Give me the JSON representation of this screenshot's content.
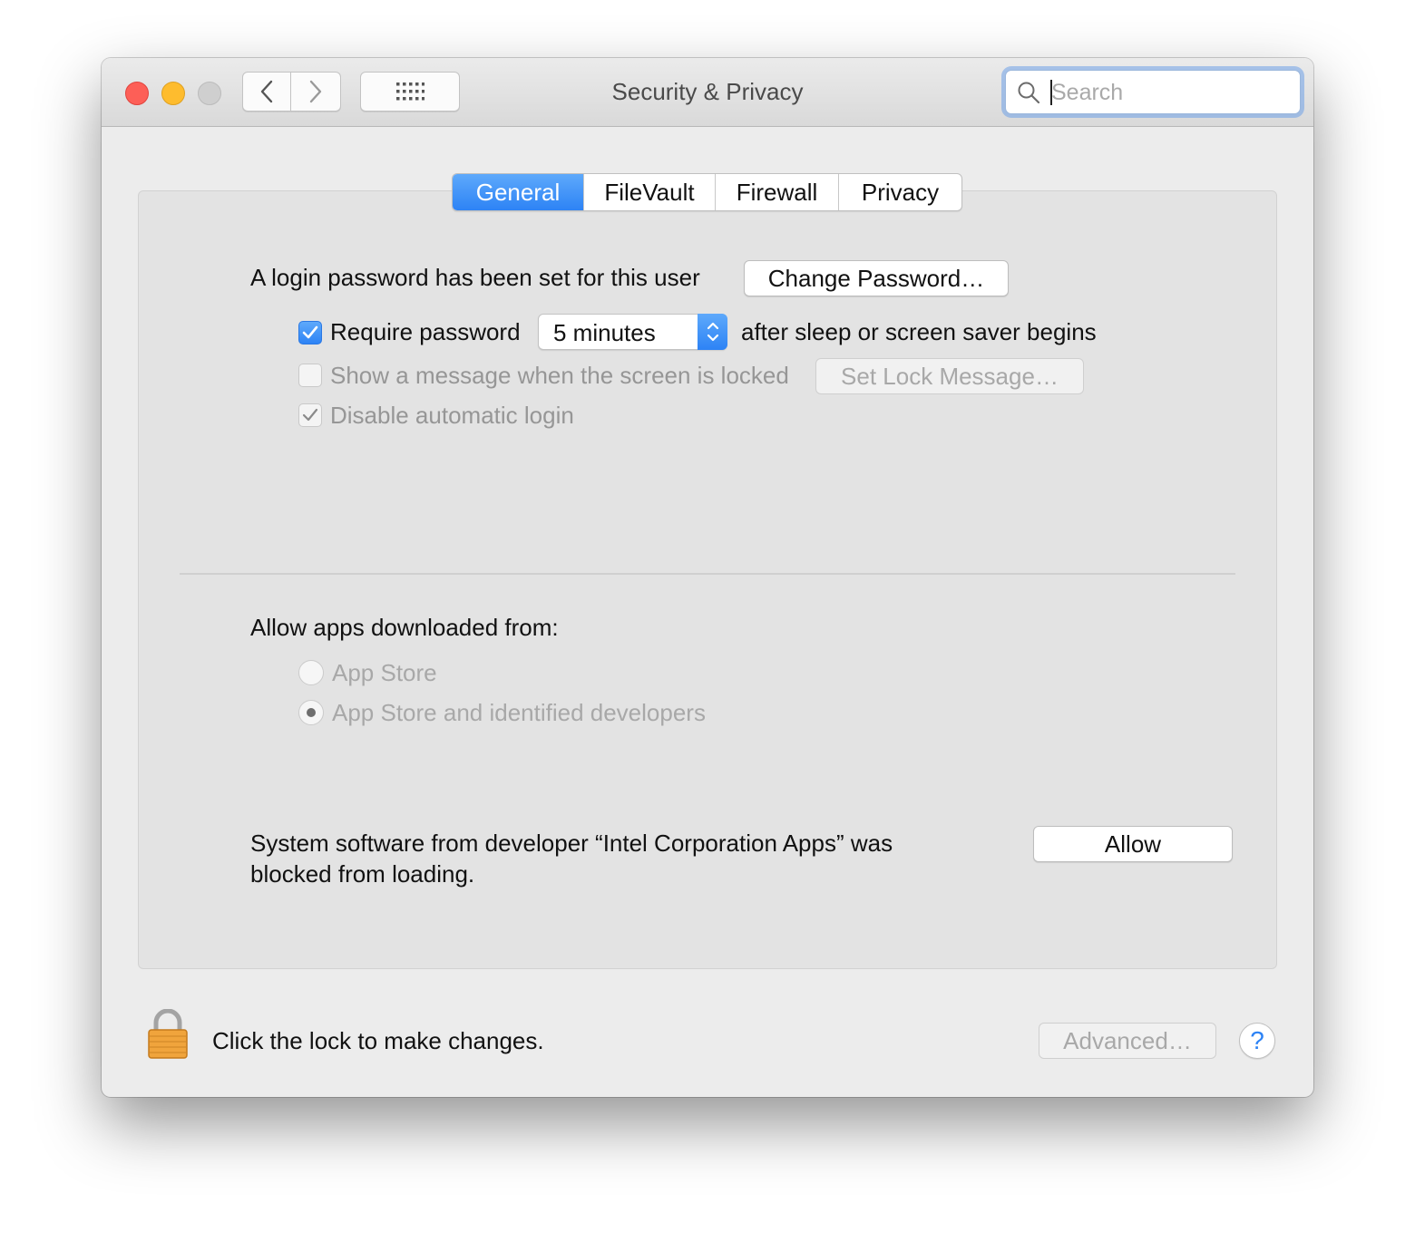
{
  "window": {
    "title": "Security & Privacy"
  },
  "toolbar": {
    "search_placeholder": "Search"
  },
  "tabs": [
    {
      "label": "General",
      "active": true
    },
    {
      "label": "FileVault",
      "active": false
    },
    {
      "label": "Firewall",
      "active": false
    },
    {
      "label": "Privacy",
      "active": false
    }
  ],
  "general": {
    "login_password_text": "A login password has been set for this user",
    "change_password_label": "Change Password…",
    "require_password": {
      "label": "Require password",
      "checked": true
    },
    "require_password_delay": "5 minutes",
    "after_sleep_text": "after sleep or screen saver begins",
    "show_message": {
      "label": "Show a message when the screen is locked",
      "checked": false,
      "enabled": false
    },
    "set_lock_message_label": "Set Lock Message…",
    "disable_auto_login": {
      "label": "Disable automatic login",
      "checked": true,
      "enabled": false
    }
  },
  "allow_apps": {
    "heading": "Allow apps downloaded from:",
    "options": [
      {
        "label": "App Store",
        "selected": false
      },
      {
        "label": "App Store and identified developers",
        "selected": true
      }
    ]
  },
  "blocked_software": {
    "line1": "System software from developer “Intel Corporation Apps” was",
    "line2": "blocked from loading.",
    "allow_label": "Allow"
  },
  "footer": {
    "lock_text": "Click the lock to make changes.",
    "advanced_label": "Advanced…",
    "help_label": "?"
  },
  "colors": {
    "accent": "#2d83f5",
    "close": "#fd5f57",
    "minimize": "#febc2e",
    "zoom_disabled": "#cfcfcf"
  }
}
